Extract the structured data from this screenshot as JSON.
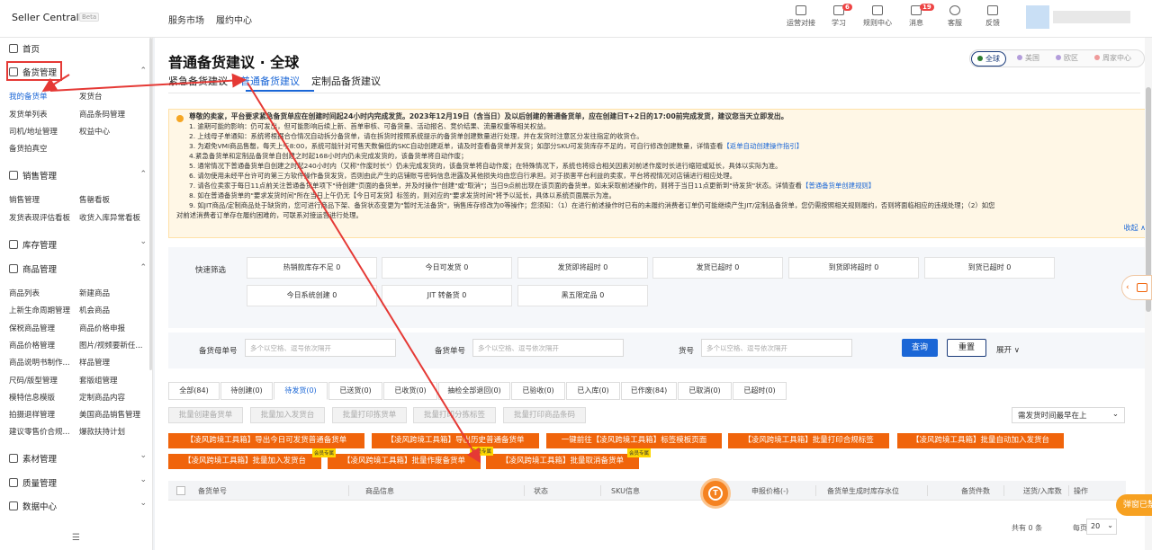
{
  "topbar": {
    "brand": "Seller Central",
    "beta": "Beta",
    "nav": [
      "服务市场",
      "履约中心"
    ],
    "icons": [
      {
        "label": "运营对接",
        "icon": "monitor-icon",
        "badge": ""
      },
      {
        "label": "学习",
        "icon": "book-icon",
        "badge": "6"
      },
      {
        "label": "规则中心",
        "icon": "document-icon",
        "badge": ""
      },
      {
        "label": "消息",
        "icon": "bell-icon",
        "badge": "19"
      },
      {
        "label": "客服",
        "icon": "headset-icon",
        "badge": ""
      },
      {
        "label": "反馈",
        "icon": "feedback-icon",
        "badge": ""
      }
    ]
  },
  "sidebar": {
    "home": "首页",
    "groups": [
      {
        "label": "备货管理",
        "icon": "box-icon"
      },
      {
        "label": "销售管理",
        "icon": "chart-icon"
      },
      {
        "label": "库存管理",
        "icon": "warehouse-icon"
      },
      {
        "label": "商品管理",
        "icon": "goods-icon"
      },
      {
        "label": "素材管理",
        "icon": "material-icon"
      },
      {
        "label": "质量管理",
        "icon": "quality-icon"
      },
      {
        "label": "数据中心",
        "icon": "data-icon"
      }
    ],
    "stock_items": [
      "我的备货单",
      "发货台",
      "发货单列表",
      "商品条码管理",
      "司机/地址管理",
      "权益中心",
      "备货拍真空"
    ],
    "sales_items": [
      "销售管理",
      "售罄看板",
      "发货表现评估看板",
      "收货入库异常看板"
    ],
    "goods_items": [
      "商品列表",
      "新建商品",
      "上新生命周期管理",
      "机会商品",
      "保税商品管理",
      "商品价格申报",
      "商品价格管理",
      "图片/视频要新任...",
      "商品说明书制作...",
      "样品管理",
      "尺码/版型管理",
      "套版组管理",
      "模特信息模版",
      "定制商品内容",
      "拍摄退样管理",
      "美国商品销售管理",
      "建议零售价合规...",
      "爆款扶持计划"
    ]
  },
  "page": {
    "title": "普通备货建议 · 全球",
    "tabs": [
      "紧急备货建议",
      "普通备货建议",
      "定制品备货建议"
    ],
    "regions": [
      "全球",
      "美国",
      "欧区",
      "周家中心"
    ],
    "region_colors": [
      "#2e7d32",
      "#7e57c2",
      "#7e57c2",
      "#e57373"
    ]
  },
  "notice": {
    "lines": [
      "尊敬的卖家，平台要求紧急备货单应在创建时间起24小时内完成发货。2023年12月19日（含当日）及以后创建的普通备货单，应在创建日T+2日的17:00前完成发货，建议您当天立即发出。",
      "1. 逾期可能的影响：仍可发出，但可能影响后续上新、首单审核、可备货量、活动报名、竞价结果、流量权重等相关权益。",
      "2. 上线母子单通知：系统将根据合仓情况自动拆分备货单，请在拆货时按照系统提示的备货单创建数量进行处理，并在发货时注意区分发往指定的收货仓。",
      "3. 为避免VMI商品售罄，每天上午8:00，系统可能针对可售天数偏低的SKC自动创建返单，请及时查看备货单并发货；如部分SKU可发货库存不足的，可自行修改创建数量，详情查看",
      "4.紧急备货单和定制品备货单自创建之时起168小时内仍未完成发货的，该备货单将自动作废；",
      "5. 通常情况下普通备货单自创建之时起240小时内（又称\"作废时长\"）仍未完成发货的，该备货单将自动作废；在特殊情况下，系统也将综合相关因素对前述作废时长进行缩短或延长，具体以实际为准。",
      "6. 请勿使用未经平台许可的第三方软件操作备货发货，否则由此产生的店铺账号密码信息泄露及其他损失均由您自行承担。对于损害平台利益的卖家，平台将视情况对店铺进行相应处理。",
      "7. 请各位卖家于每日11点前关注普通备货单项下\"待创建\"页面的备货单，并及时操作\"创建\"或\"取消\"；当日9点前出现在该页面的备货单，如未采取前述操作的，则将于当日11点更新到\"待发货\"状态。详情查看",
      "8. 如在普通备货单的\"要求发货时间\"所在当日上午仍无【今日可发货】标签的，则对应的\"要求发货时间\"将予以延长，具体以系统页面展示为准。",
      "9. 如JIT商品/定制商品处于缺货的，您可进行商品下架、备货状态变更为\"暂时无法备货\"，销售库存修改为0等操作；您须知：（1）在进行前述操作时已有的未履约消费者订单仍可能继续产生JIT/定制品备货单，您仍需按照相关规则履约，否则将面临相应的违规处理；（2）如您",
      "对前述消费者订单存在履约困难的，可联系对接运营进行处理。"
    ],
    "link_return": "【返单自动创建操作指引】",
    "link_create": "【普通备货单创建规则】",
    "fold": "收起 ∧"
  },
  "filters": {
    "label": "快速筛选",
    "chips": [
      "热销款库存不足 0",
      "今日可发货 0",
      "发货即将超时 0",
      "发货已超时 0",
      "到货即将超时 0",
      "到货已超时 0",
      "今日系统创建 0",
      "JIT 转备货 0",
      "黑五限定品 0"
    ]
  },
  "search": {
    "fields": [
      {
        "label": "备货母单号",
        "placeholder": "多个以空格、逗号依次隔开"
      },
      {
        "label": "备货单号",
        "placeholder": "多个以空格、逗号依次隔开"
      },
      {
        "label": "货号",
        "placeholder": "多个以空格、逗号依次隔开"
      }
    ],
    "query": "查询",
    "reset": "重置",
    "expand": "展开 ∨"
  },
  "status_tabs": [
    "全部(84)",
    "待创建(0)",
    "待发货(0)",
    "已送货(0)",
    "已收货(0)",
    "抽检全部退回(0)",
    "已验收(0)",
    "已入库(0)",
    "已作废(84)",
    "已取消(0)",
    "已超时(0)"
  ],
  "bulk_buttons": [
    "批量创建备货单",
    "批量加入发货台",
    "批量打印拣货单",
    "批量打印分拣标签",
    "批量打印商品条码"
  ],
  "sort": "需发货时间最早在上",
  "plugin_buttons": [
    "【凌风跨境工具箱】导出今日可发货普通备货单",
    "【凌风跨境工具箱】导出历史普通备货单",
    "一键前往【凌风跨境工具箱】标签模板页面",
    "【凌风跨境工具箱】批量打印合规标签",
    "【凌风跨境工具箱】批量自动加入发货台",
    "【凌风跨境工具箱】批量加入发货台",
    "【凌风跨境工具箱】批量作废备货单",
    "【凌风跨境工具箱】批量取消备货单"
  ],
  "plugin_tag": "会员专属",
  "table_headers": [
    "备货单号",
    "商品信息",
    "状态",
    "SKU信息",
    "申报价格(-)",
    "备货单生成时库存水位",
    "备货件数",
    "送货/入库数",
    "操作"
  ],
  "pager": {
    "total": "共有 0 条",
    "per_page_label": "每页",
    "per_page": "20"
  },
  "popup": "弹窗已禁用",
  "fab_icon": "T"
}
